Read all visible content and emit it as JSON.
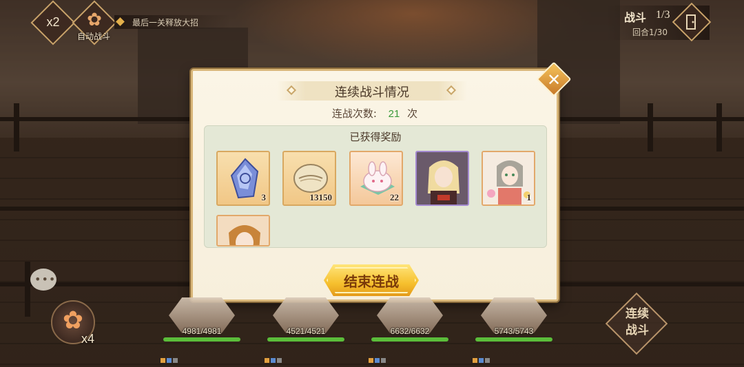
{
  "hud": {
    "speed_label": "x2",
    "auto_battle_label": "自动战斗",
    "hint_text": "最后一关释放大招",
    "battle_title": "战斗",
    "battle_count": "1/3",
    "round_text": "回合1/30",
    "skill_count": "x4",
    "combo_label_line1": "连续",
    "combo_label_line2": "战斗",
    "chat_icon": "chat-bubble-icon"
  },
  "dialog": {
    "title": "连续战斗情况",
    "streak_label": "连战次数:",
    "streak_value": "21",
    "streak_unit": "次",
    "rewards_title": "已获得奖励",
    "end_button": "结束连战",
    "close_icon": "close-icon",
    "rewards": [
      {
        "name": "crystal-stone",
        "count": "3",
        "rarity": "gold"
      },
      {
        "name": "shell-currency",
        "count": "13150",
        "rarity": "gold"
      },
      {
        "name": "bunny-dumpling",
        "count": "22",
        "rarity": "orange"
      },
      {
        "name": "hero-card-blonde",
        "count": "",
        "rarity": "purple"
      },
      {
        "name": "hero-card-flower-girl",
        "count": "1",
        "rarity": "orange"
      },
      {
        "name": "hero-card-red-hair",
        "count": "",
        "rarity": "orange"
      }
    ]
  },
  "team": [
    {
      "hp": "4981/4981",
      "hp_fraction": 1.0
    },
    {
      "hp": "4521/4521",
      "hp_fraction": 1.0
    },
    {
      "hp": "6632/6632",
      "hp_fraction": 1.0
    },
    {
      "hp": "5743/5743",
      "hp_fraction": 1.0
    }
  ],
  "colors": {
    "accent_gold": "#f6c02e",
    "streak_green": "#3a9a3a",
    "panel_bg": "#fbf5e6"
  }
}
